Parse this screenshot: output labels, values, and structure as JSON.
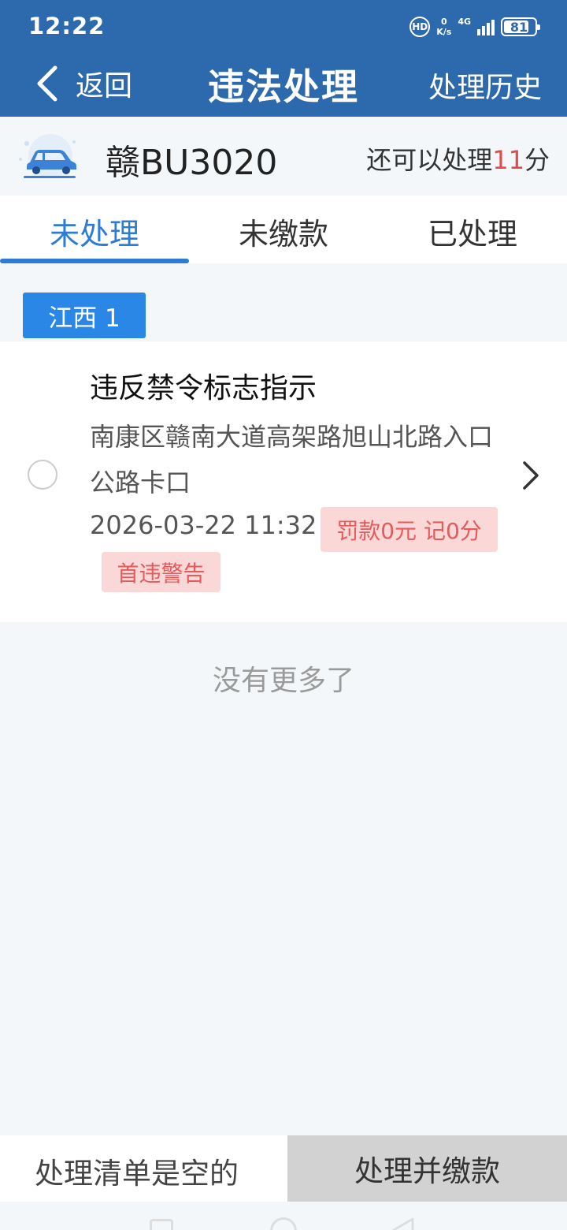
{
  "status_bar": {
    "time": "12:22",
    "hd_label": "HD",
    "speed_value": "0",
    "speed_unit": "K/s",
    "network": "4G",
    "battery": "81",
    "battery_level_percent": 81
  },
  "nav": {
    "back_label": "返回",
    "title": "违法处理",
    "history_label": "处理历史"
  },
  "vehicle": {
    "plate": "赣BU3020",
    "points_prefix": "还可以处理",
    "points_value": "11",
    "points_suffix": "分"
  },
  "tabs": [
    {
      "label": "未处理",
      "active": true
    },
    {
      "label": "未缴款",
      "active": false
    },
    {
      "label": "已处理",
      "active": false
    }
  ],
  "region_badge": "江西 1",
  "violation": {
    "title": "违反禁令标志指示",
    "location": "南康区赣南大道高架路旭山北路入口公路卡口",
    "datetime": "2026-03-22 11:32",
    "fine_tag": "罚款0元 记0分",
    "first_offense_tag": "首违警告"
  },
  "no_more_text": "没有更多了",
  "bottom_bar": {
    "cart_text": "处理清单是空的",
    "pay_button": "处理并缴款"
  },
  "colors": {
    "primary": "#2c69ad",
    "tab_active": "#2c7bd6",
    "badge": "#2b87e6",
    "tag_bg": "#fbd8d8",
    "tag_text": "#e35b5b",
    "points_red": "#e04a4a"
  },
  "icons": {
    "back": "chevron-left-icon",
    "car": "car-icon",
    "disclosure": "chevron-right-icon",
    "radio": "radio-unchecked-icon"
  }
}
